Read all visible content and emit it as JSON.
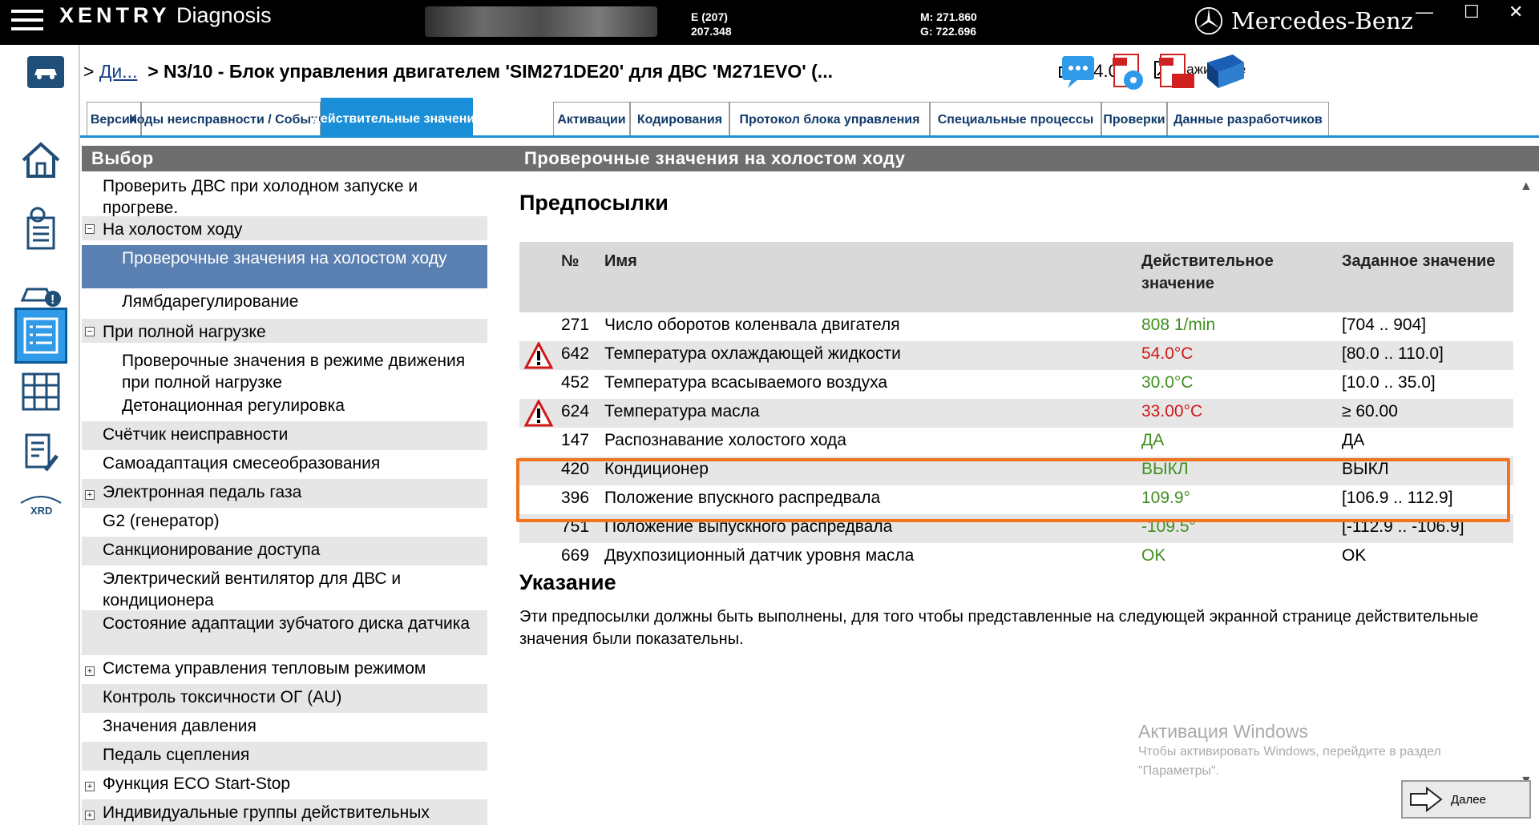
{
  "title_bar": {
    "app_name_brand": "XENTRY",
    "app_name_rest": "Diagnosis",
    "vin_line1": "E (207)",
    "vin_line2": "207.348",
    "mg_line1": "M: 271.860",
    "mg_line2": "G: 722.696",
    "brand": "Mercedes-Benz"
  },
  "header": {
    "breadcrumb_link": "Ди...",
    "breadcrumb_current": "> N3/10 - Блок управления двигателем 'SIM271DE20' для ДВС 'M271EVO' (...",
    "battery": "14.0V",
    "ignition": "Зажигание"
  },
  "tabs": [
    {
      "label": "Версия"
    },
    {
      "label": "Коды неисправности / События"
    },
    {
      "label": "Действительные значения"
    },
    {
      "label": "Активации"
    },
    {
      "label": "Кодирования"
    },
    {
      "label": "Протокол блока управления"
    },
    {
      "label": "Специальные процессы"
    },
    {
      "label": "Проверки"
    },
    {
      "label": "Данные разработчиков"
    }
  ],
  "left_panel": {
    "title": "Выбор",
    "items": [
      {
        "label": "Проверить ДВС при холодном запуске и прогреве."
      },
      {
        "label": "На холостом ходу"
      },
      {
        "label": "Проверочные значения на холостом ходу"
      },
      {
        "label": "Лямбдарегулирование"
      },
      {
        "label": "При полной нагрузке"
      },
      {
        "label": "Проверочные значения в режиме движения при полной нагрузке"
      },
      {
        "label": "Детонационная регулировка"
      },
      {
        "label": "Счётчик неисправности"
      },
      {
        "label": "Самоадаптация смесеобразования"
      },
      {
        "label": "Электронная педаль газа"
      },
      {
        "label": "G2 (генератор)"
      },
      {
        "label": "Санкционирование доступа"
      },
      {
        "label": "Электрический вентилятор для ДВС и кондиционера"
      },
      {
        "label": "Состояние адаптации зубчатого диска датчика"
      },
      {
        "label": "Система управления тепловым режимом"
      },
      {
        "label": "Контроль токсичности ОГ (AU)"
      },
      {
        "label": "Значения давления"
      },
      {
        "label": "Педаль сцепления"
      },
      {
        "label": "Функция ECO Start-Stop"
      },
      {
        "label": "Индивидуальные группы действительных"
      }
    ],
    "expand_minus": "−",
    "expand_plus": "+"
  },
  "right_panel": {
    "title": "Проверочные значения на холостом ходу",
    "prereq_heading": "Предпосылки",
    "columns": {
      "no": "№",
      "name": "Имя",
      "actual_1": "Действительное",
      "actual_2": "значение",
      "target": "Заданное значение"
    },
    "rows": [
      {
        "no": "271",
        "name": "Число оборотов коленвала двигателя",
        "actual": "808 1/min",
        "target": "[704 .. 904]",
        "status": "ok",
        "warning": false
      },
      {
        "no": "642",
        "name": "Температура охлаждающей жидкости",
        "actual": "54.0°C",
        "target": "[80.0 .. 110.0]",
        "status": "bad",
        "warning": true
      },
      {
        "no": "452",
        "name": "Температура всасываемого воздуха",
        "actual": "30.0°C",
        "target": "[10.0 .. 35.0]",
        "status": "ok",
        "warning": false
      },
      {
        "no": "624",
        "name": "Температура масла",
        "actual": "33.00°C",
        "target": "≥ 60.00",
        "status": "bad",
        "warning": true
      },
      {
        "no": "147",
        "name": "Распознавание холостого хода",
        "actual": "ДА",
        "target": "ДА",
        "status": "ok",
        "warning": false
      },
      {
        "no": "420",
        "name": "Кондиционер",
        "actual": "ВЫКЛ",
        "target": "ВЫКЛ",
        "status": "ok",
        "warning": false
      },
      {
        "no": "396",
        "name": "Положение впускного распредвала",
        "actual": "109.9°",
        "target": "[106.9 .. 112.9]",
        "status": "ok",
        "warning": false
      },
      {
        "no": "751",
        "name": "Положение выпускного распредвала",
        "actual": "-109.5°",
        "target": "[-112.9 .. -106.9]",
        "status": "ok",
        "warning": false
      },
      {
        "no": "669",
        "name": "Двухпозиционный датчик уровня масла",
        "actual": "OK",
        "target": "OK",
        "status": "ok",
        "warning": false
      }
    ],
    "note_heading": "Указание",
    "note_text": "Эти предпосылки должны быть выполнены, для того чтобы представленные на следующей экранной странице действительные значения были показательны.",
    "next_button": "Далее"
  },
  "watermark": {
    "line1": "Активация Windows",
    "line2": "Чтобы активировать Windows, перейдите в раздел",
    "line3": "\"Параметры\"."
  },
  "colors": {
    "tab_active": "#1a8fd8",
    "selection": "#5a7fb1",
    "value_ok": "#3f8f1e",
    "value_bad": "#d01818",
    "highlight": "#f07320"
  }
}
